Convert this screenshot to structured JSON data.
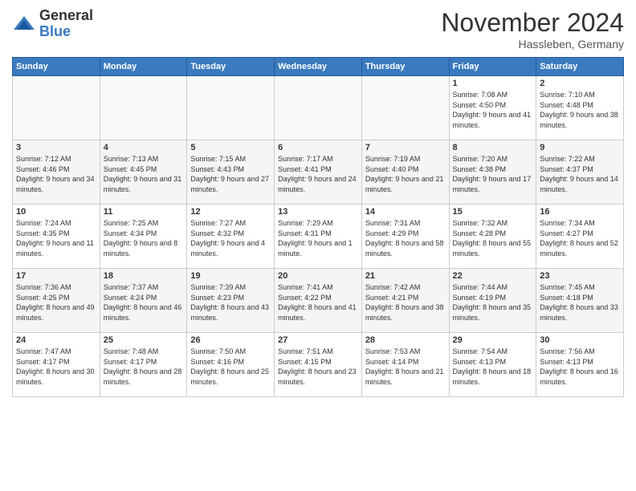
{
  "header": {
    "logo_general": "General",
    "logo_blue": "Blue",
    "month_title": "November 2024",
    "location": "Hassleben, Germany"
  },
  "weekdays": [
    "Sunday",
    "Monday",
    "Tuesday",
    "Wednesday",
    "Thursday",
    "Friday",
    "Saturday"
  ],
  "weeks": [
    [
      {
        "day": "",
        "info": ""
      },
      {
        "day": "",
        "info": ""
      },
      {
        "day": "",
        "info": ""
      },
      {
        "day": "",
        "info": ""
      },
      {
        "day": "",
        "info": ""
      },
      {
        "day": "1",
        "info": "Sunrise: 7:08 AM\nSunset: 4:50 PM\nDaylight: 9 hours and 41 minutes."
      },
      {
        "day": "2",
        "info": "Sunrise: 7:10 AM\nSunset: 4:48 PM\nDaylight: 9 hours and 38 minutes."
      }
    ],
    [
      {
        "day": "3",
        "info": "Sunrise: 7:12 AM\nSunset: 4:46 PM\nDaylight: 9 hours and 34 minutes."
      },
      {
        "day": "4",
        "info": "Sunrise: 7:13 AM\nSunset: 4:45 PM\nDaylight: 9 hours and 31 minutes."
      },
      {
        "day": "5",
        "info": "Sunrise: 7:15 AM\nSunset: 4:43 PM\nDaylight: 9 hours and 27 minutes."
      },
      {
        "day": "6",
        "info": "Sunrise: 7:17 AM\nSunset: 4:41 PM\nDaylight: 9 hours and 24 minutes."
      },
      {
        "day": "7",
        "info": "Sunrise: 7:19 AM\nSunset: 4:40 PM\nDaylight: 9 hours and 21 minutes."
      },
      {
        "day": "8",
        "info": "Sunrise: 7:20 AM\nSunset: 4:38 PM\nDaylight: 9 hours and 17 minutes."
      },
      {
        "day": "9",
        "info": "Sunrise: 7:22 AM\nSunset: 4:37 PM\nDaylight: 9 hours and 14 minutes."
      }
    ],
    [
      {
        "day": "10",
        "info": "Sunrise: 7:24 AM\nSunset: 4:35 PM\nDaylight: 9 hours and 11 minutes."
      },
      {
        "day": "11",
        "info": "Sunrise: 7:25 AM\nSunset: 4:34 PM\nDaylight: 9 hours and 8 minutes."
      },
      {
        "day": "12",
        "info": "Sunrise: 7:27 AM\nSunset: 4:32 PM\nDaylight: 9 hours and 4 minutes."
      },
      {
        "day": "13",
        "info": "Sunrise: 7:29 AM\nSunset: 4:31 PM\nDaylight: 9 hours and 1 minute."
      },
      {
        "day": "14",
        "info": "Sunrise: 7:31 AM\nSunset: 4:29 PM\nDaylight: 8 hours and 58 minutes."
      },
      {
        "day": "15",
        "info": "Sunrise: 7:32 AM\nSunset: 4:28 PM\nDaylight: 8 hours and 55 minutes."
      },
      {
        "day": "16",
        "info": "Sunrise: 7:34 AM\nSunset: 4:27 PM\nDaylight: 8 hours and 52 minutes."
      }
    ],
    [
      {
        "day": "17",
        "info": "Sunrise: 7:36 AM\nSunset: 4:25 PM\nDaylight: 8 hours and 49 minutes."
      },
      {
        "day": "18",
        "info": "Sunrise: 7:37 AM\nSunset: 4:24 PM\nDaylight: 8 hours and 46 minutes."
      },
      {
        "day": "19",
        "info": "Sunrise: 7:39 AM\nSunset: 4:23 PM\nDaylight: 8 hours and 43 minutes."
      },
      {
        "day": "20",
        "info": "Sunrise: 7:41 AM\nSunset: 4:22 PM\nDaylight: 8 hours and 41 minutes."
      },
      {
        "day": "21",
        "info": "Sunrise: 7:42 AM\nSunset: 4:21 PM\nDaylight: 8 hours and 38 minutes."
      },
      {
        "day": "22",
        "info": "Sunrise: 7:44 AM\nSunset: 4:19 PM\nDaylight: 8 hours and 35 minutes."
      },
      {
        "day": "23",
        "info": "Sunrise: 7:45 AM\nSunset: 4:18 PM\nDaylight: 8 hours and 33 minutes."
      }
    ],
    [
      {
        "day": "24",
        "info": "Sunrise: 7:47 AM\nSunset: 4:17 PM\nDaylight: 8 hours and 30 minutes."
      },
      {
        "day": "25",
        "info": "Sunrise: 7:48 AM\nSunset: 4:17 PM\nDaylight: 8 hours and 28 minutes."
      },
      {
        "day": "26",
        "info": "Sunrise: 7:50 AM\nSunset: 4:16 PM\nDaylight: 8 hours and 25 minutes."
      },
      {
        "day": "27",
        "info": "Sunrise: 7:51 AM\nSunset: 4:15 PM\nDaylight: 8 hours and 23 minutes."
      },
      {
        "day": "28",
        "info": "Sunrise: 7:53 AM\nSunset: 4:14 PM\nDaylight: 8 hours and 21 minutes."
      },
      {
        "day": "29",
        "info": "Sunrise: 7:54 AM\nSunset: 4:13 PM\nDaylight: 8 hours and 18 minutes."
      },
      {
        "day": "30",
        "info": "Sunrise: 7:56 AM\nSunset: 4:13 PM\nDaylight: 8 hours and 16 minutes."
      }
    ]
  ]
}
